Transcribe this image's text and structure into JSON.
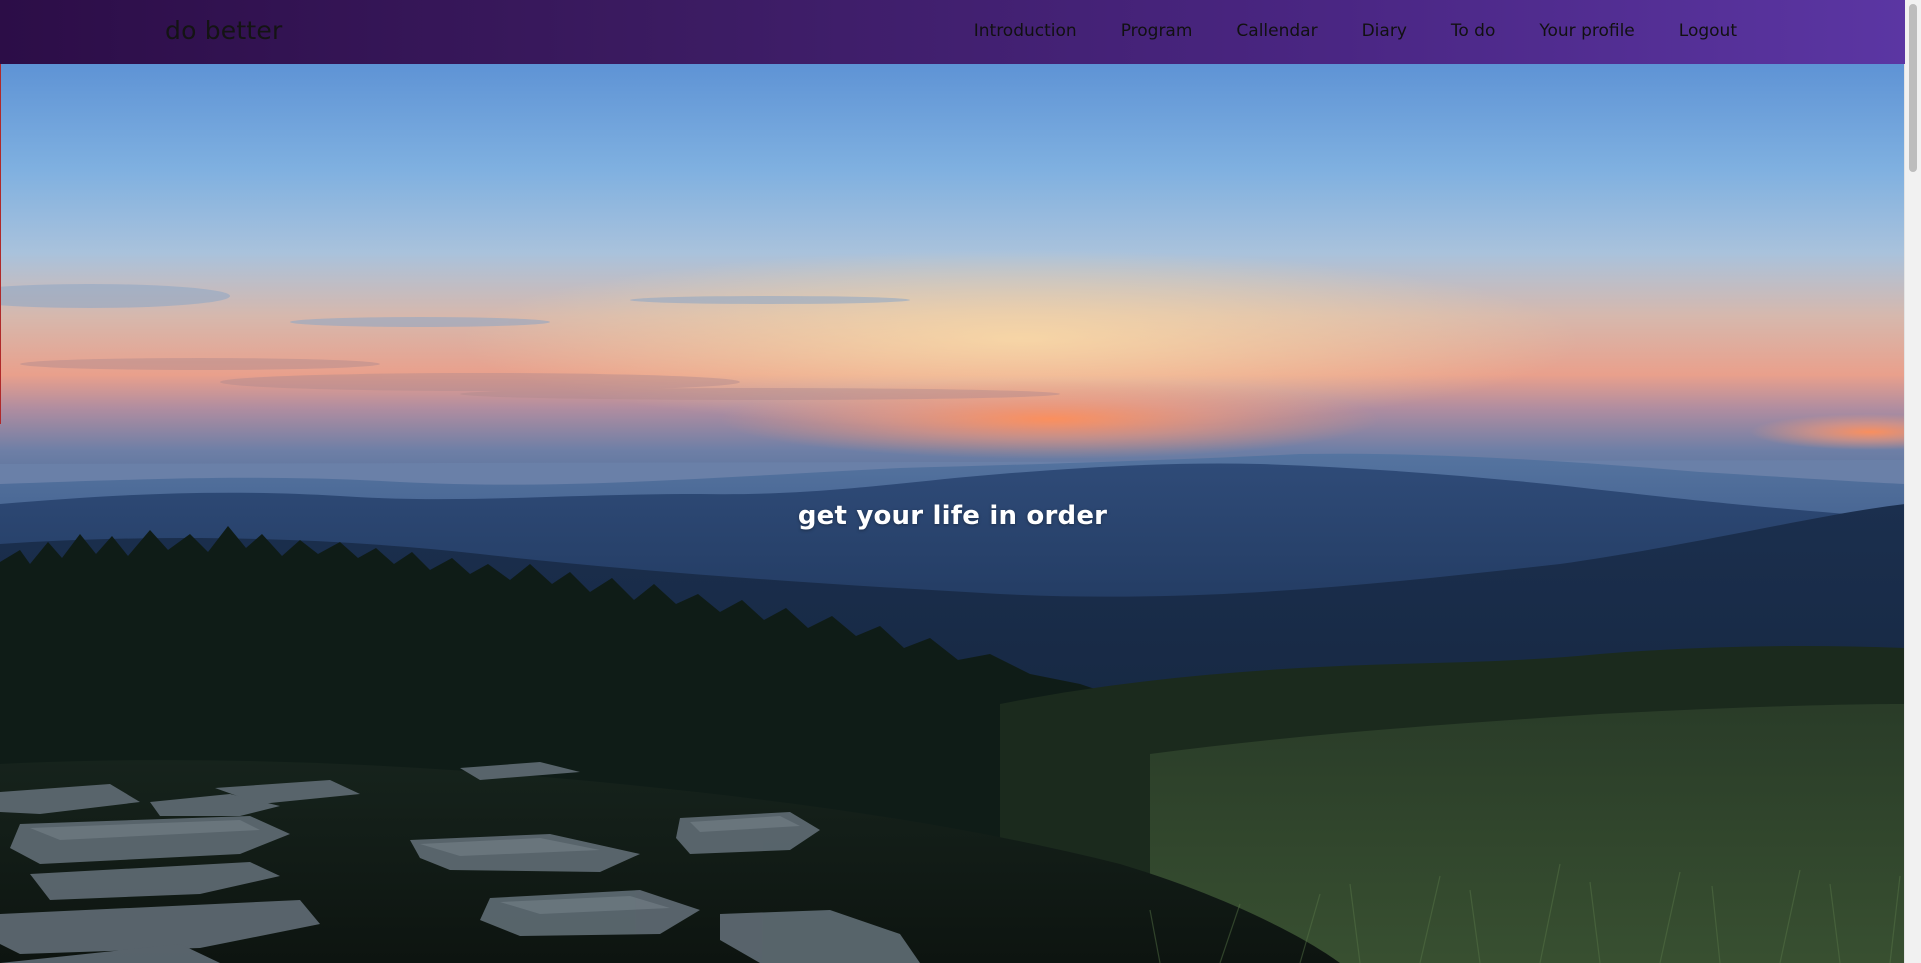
{
  "brand": "do better",
  "nav": {
    "items": [
      {
        "label": "Introduction"
      },
      {
        "label": "Program"
      },
      {
        "label": "Callendar"
      },
      {
        "label": "Diary"
      },
      {
        "label": "To do"
      },
      {
        "label": "Your profile"
      },
      {
        "label": "Logout"
      }
    ]
  },
  "hero": {
    "tagline": "get your life in order"
  },
  "colors": {
    "navbar_start": "#2c0d47",
    "navbar_end": "#5b36a3",
    "nav_text": "#111111",
    "tagline_text": "#ffffff"
  }
}
